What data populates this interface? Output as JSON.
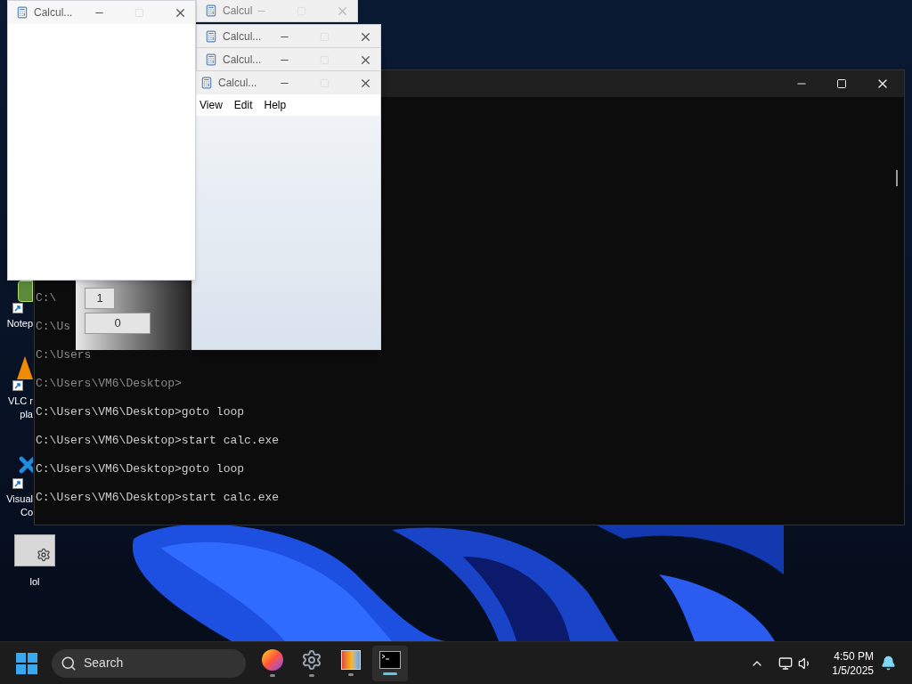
{
  "desktop_icons": [
    {
      "kind": "notepad",
      "shortcut": true,
      "label_lines": [
        "Notep"
      ]
    },
    {
      "kind": "vlc",
      "shortcut": true,
      "label_lines": [
        "VLC r",
        "pla"
      ]
    },
    {
      "kind": "code",
      "shortcut": true,
      "label_lines": [
        "Visual",
        "Co"
      ]
    },
    {
      "kind": "folder",
      "shortcut": false,
      "label_lines": [
        "lol"
      ]
    }
  ],
  "console": {
    "lines": [
      {
        "text": "C:\\",
        "dimmed": true
      },
      {
        "text": "C:\\Us",
        "dimmed": true
      },
      {
        "text": "C:\\Users",
        "dimmed": true
      },
      {
        "text": "C:\\Users\\VM6\\Desktop>",
        "dimmed": true
      },
      {
        "text": "C:\\Users\\VM6\\Desktop>goto loop",
        "dimmed": false
      },
      {
        "text": "C:\\Users\\VM6\\Desktop>start calc.exe",
        "dimmed": false
      },
      {
        "text": "C:\\Users\\VM6\\Desktop>goto loop",
        "dimmed": false
      },
      {
        "text": "C:\\Users\\VM6\\Desktop>start calc.exe",
        "dimmed": false
      }
    ]
  },
  "ghost_calculator": {
    "keys": [
      "1",
      "0"
    ]
  },
  "calculator_windows": [
    {
      "title": "Calcul...",
      "dimmed": false
    },
    {
      "title": "Calcul",
      "dimmed": true
    },
    {
      "title": "Calcul...",
      "dimmed": false
    },
    {
      "title": "Calcul...",
      "dimmed": false
    },
    {
      "title": "Calcul...",
      "dimmed": false,
      "menu": [
        "View",
        "Edit",
        "Help"
      ]
    }
  ],
  "taskbar": {
    "search": {
      "placeholder": "Search"
    },
    "apps": [
      {
        "kind": "browser",
        "selected": false
      },
      {
        "kind": "settings",
        "selected": false
      },
      {
        "kind": "panel",
        "selected": false
      },
      {
        "kind": "terminal",
        "selected": true
      }
    ],
    "time": "4:50 PM",
    "date": "1/5/2025"
  }
}
